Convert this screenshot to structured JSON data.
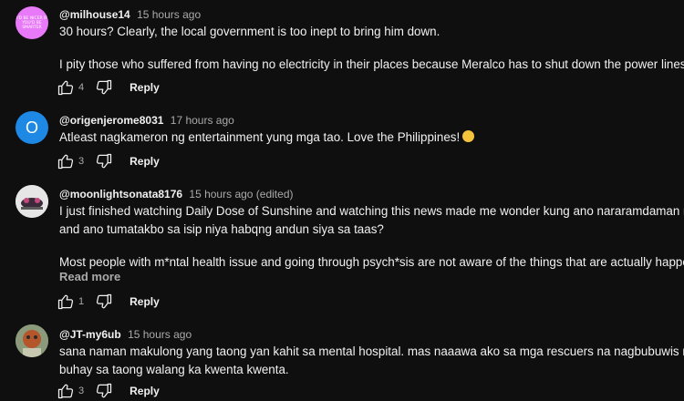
{
  "comments": [
    {
      "username": "@milhouse14",
      "time": "15 hours ago",
      "avatar_text": "I'D BE NICER IF YOU'D BE SMARTER",
      "lines": [
        "30 hours? Clearly, the local government is too inept to bring him down.",
        "",
        "I pity those who suffered from having no electricity in their places because Meralco has to shut down the power lines."
      ],
      "likes": "4",
      "reply": "Reply"
    },
    {
      "username": "@origenjerome8031",
      "time": "17 hours ago",
      "avatar_letter": "O",
      "lines": [
        "Atleast nagkameron ng entertainment yung mga tao. Love the Philippines!"
      ],
      "emoji": "grinning-face-emoji",
      "likes": "3",
      "reply": "Reply"
    },
    {
      "username": "@moonlightsonata8176",
      "time": "15 hours ago (edited)",
      "lines": [
        "I just finished watching Daily Dose of Sunshine and watching this news made me wonder kung ano nararamdaman niya",
        "and ano tumatakbo sa isip niya habqng andun siya sa taas?",
        "",
        "Most people with m*ntal health issue and going through psych*sis are not aware of the things that are actually happenin.."
      ],
      "read_more": "Read more",
      "likes": "1",
      "reply": "Reply"
    },
    {
      "username": "@JT-my6ub",
      "time": "15 hours ago",
      "lines": [
        "sana naman makulong yang taong yan kahit sa mental hospital. mas naaawa ako sa mga rescuers na nagbubuwis ng",
        "buhay sa taong walang ka kwenta kwenta."
      ],
      "likes": "3",
      "reply": "Reply"
    }
  ],
  "colors": {
    "background": "#0f0f0f",
    "text": "#f1f1f1",
    "muted": "#aaaaaa",
    "avatar_pink": "#e879f9",
    "avatar_blue": "#1e88e5"
  },
  "icons": [
    "like-icon",
    "dislike-icon"
  ]
}
